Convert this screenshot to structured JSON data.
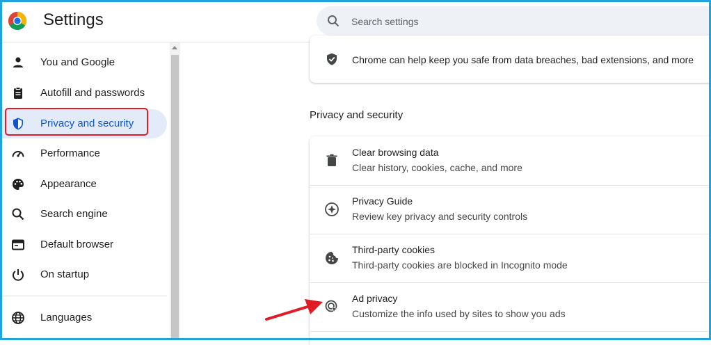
{
  "header": {
    "title": "Settings",
    "search_placeholder": "Search settings"
  },
  "sidebar": {
    "items": [
      {
        "label": "You and Google",
        "icon": "person-icon"
      },
      {
        "label": "Autofill and passwords",
        "icon": "clipboard-icon"
      },
      {
        "label": "Privacy and security",
        "icon": "shield-icon",
        "active": true
      },
      {
        "label": "Performance",
        "icon": "speedometer-icon"
      },
      {
        "label": "Appearance",
        "icon": "palette-icon"
      },
      {
        "label": "Search engine",
        "icon": "search-icon"
      },
      {
        "label": "Default browser",
        "icon": "browser-window-icon"
      },
      {
        "label": "On startup",
        "icon": "power-icon"
      },
      {
        "label": "Languages",
        "icon": "globe-icon"
      }
    ]
  },
  "main": {
    "safety_card": {
      "text": "Chrome can help keep you safe from data breaches, bad extensions, and more",
      "icon": "shield-check-icon"
    },
    "section_title": "Privacy and security",
    "rows": [
      {
        "title": "Clear browsing data",
        "subtitle": "Clear history, cookies, cache, and more",
        "icon": "trash-icon"
      },
      {
        "title": "Privacy Guide",
        "subtitle": "Review key privacy and security controls",
        "icon": "compass-icon"
      },
      {
        "title": "Third-party cookies",
        "subtitle": "Third-party cookies are blocked in Incognito mode",
        "icon": "cookie-icon"
      },
      {
        "title": "Ad privacy",
        "subtitle": "Customize the info used by sites to show you ads",
        "icon": "ad-privacy-icon"
      }
    ]
  },
  "colors": {
    "accent": "#0b57d0",
    "active_bg": "#e3ebf8",
    "annotation_red": "#e01b24",
    "frame_blue": "#1ea5e0"
  }
}
